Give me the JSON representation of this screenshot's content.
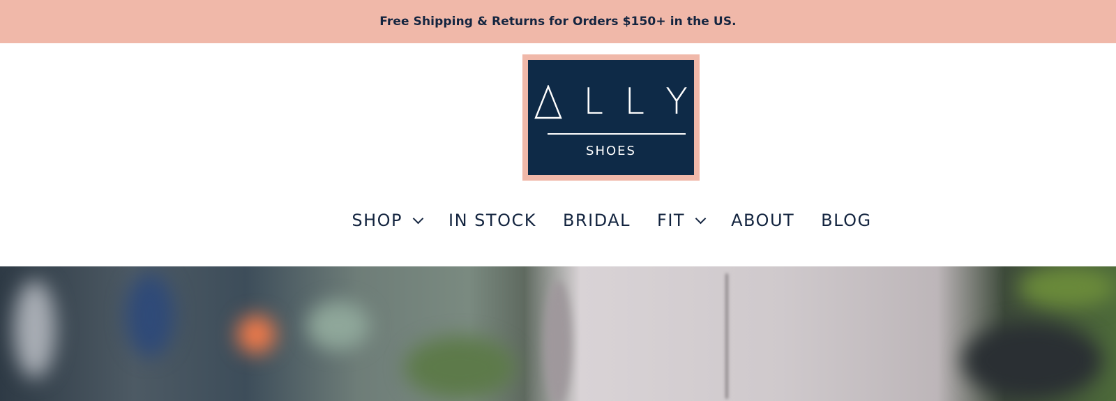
{
  "announcement": {
    "text": "Free Shipping & Returns for Orders $150+ in the US."
  },
  "logo": {
    "letters": [
      "△",
      "L",
      "L",
      "Y"
    ],
    "subtitle": "SHOES",
    "colors": {
      "frame": "#f0b8a9",
      "panel": "#0e2a47",
      "text": "#ffffff"
    }
  },
  "nav": {
    "items": [
      {
        "label": "SHOP",
        "icon": "chevron-down-icon"
      },
      {
        "label": "IN STOCK"
      },
      {
        "label": "BRIDAL"
      },
      {
        "label": "FIT",
        "icon": "chevron-down-icon"
      },
      {
        "label": "ABOUT"
      },
      {
        "label": "BLOG"
      }
    ]
  },
  "colors": {
    "announcement_bg": "#f0b8a9",
    "text_primary": "#13243f"
  }
}
